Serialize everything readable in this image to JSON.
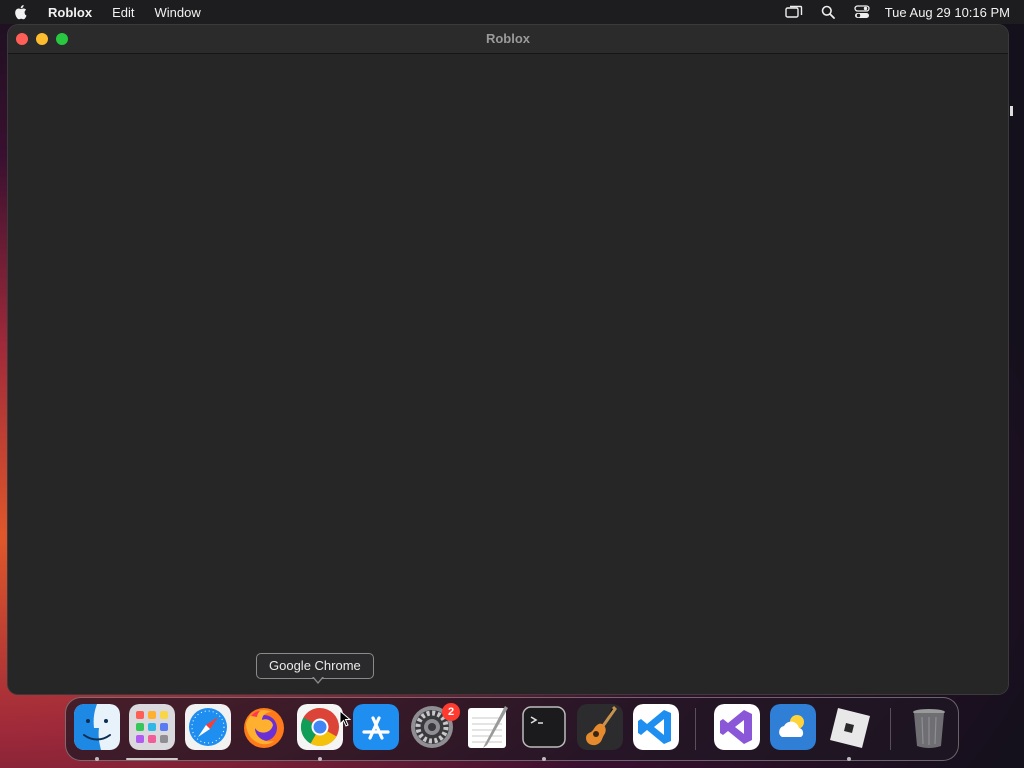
{
  "menubar": {
    "apple_icon": "apple-logo",
    "app_name": "Roblox",
    "menus": [
      "Edit",
      "Window"
    ],
    "status_icons": [
      "screen-mirroring-icon",
      "spotlight-search-icon",
      "control-center-icon"
    ],
    "clock": "Tue Aug 29  10:16 PM"
  },
  "window": {
    "title": "Roblox",
    "traffic_colors": {
      "close": "#ff5f57",
      "minimize": "#febc2e",
      "maximize": "#28c840"
    }
  },
  "tooltip": {
    "text": "Google Chrome"
  },
  "dock": {
    "items": [
      {
        "name": "Finder",
        "running": true
      },
      {
        "name": "Launchpad",
        "running": false
      },
      {
        "name": "Safari",
        "running": false
      },
      {
        "name": "Firefox",
        "running": false
      },
      {
        "name": "Google Chrome",
        "running": true
      },
      {
        "name": "App Store",
        "running": false
      },
      {
        "name": "System Settings",
        "running": false,
        "badge": "2"
      },
      {
        "name": "TextEdit",
        "running": false
      },
      {
        "name": "Terminal",
        "running": true
      },
      {
        "name": "GarageBand",
        "running": false
      },
      {
        "name": "Visual Studio Code",
        "running": false
      },
      {
        "name": "Visual Studio",
        "running": false
      },
      {
        "name": "Weather",
        "running": false
      },
      {
        "name": "Roblox",
        "running": true
      },
      {
        "name": "Trash",
        "running": false
      }
    ]
  }
}
